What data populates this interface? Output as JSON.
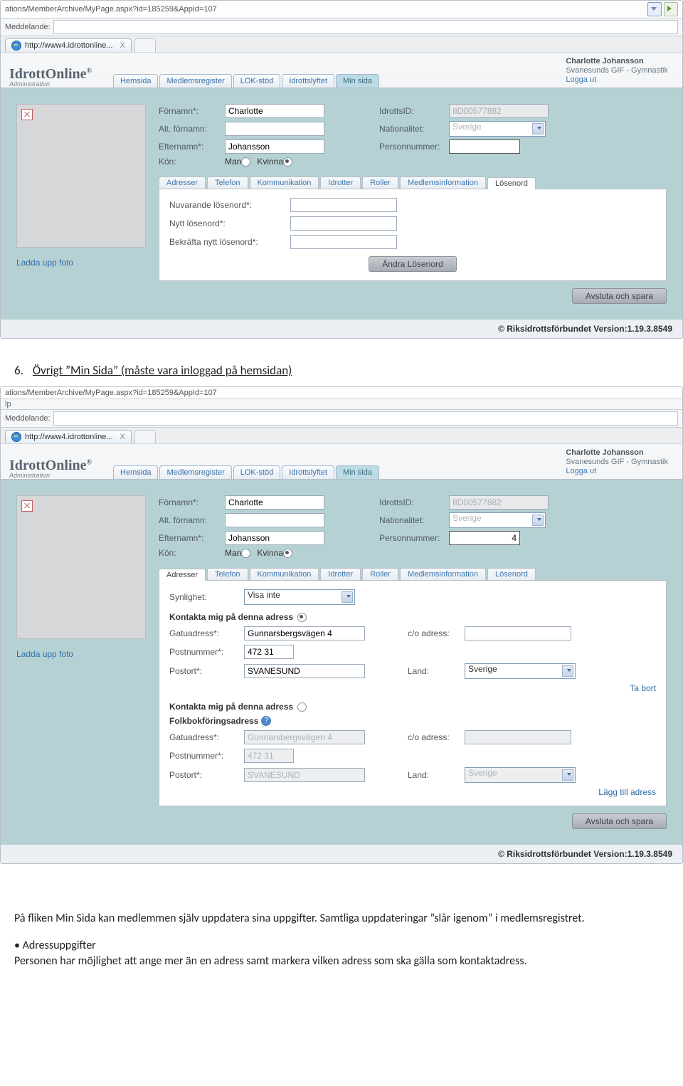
{
  "browser": {
    "url": "ations/MemberArchive/MyPage.aspx?id=185259&AppId=107",
    "help": "lp",
    "meddelande_label": "Meddelande:",
    "tab_title": "http://www4.idrottonline...",
    "tab_close_x": "X"
  },
  "app": {
    "logo": "IdrottOnline",
    "logo_r": "®",
    "logo_sub": "Administration",
    "nav": [
      "Hemsida",
      "Medlemsregister",
      "LOK-stöd",
      "Idrottslyftet",
      "Min sida"
    ],
    "user_name": "Charlotte Johansson",
    "user_org": "Svanesunds GIF - Gymnastik",
    "logout": "Logga ut"
  },
  "person": {
    "labels": {
      "fornamn": "Förnamn*:",
      "alt_fornamn": "Alt. förnamn:",
      "efternamn": "Efternamn*:",
      "kon": "Kön:",
      "man": "Man",
      "kvinna": "Kvinna",
      "idrottsid": "IdrottsID:",
      "nationalitet": "Nationalitet:",
      "personnummer": "Personnummer:"
    },
    "fornamn": "Charlotte",
    "alt_fornamn": "",
    "efternamn": "Johansson",
    "idrottsid": "IID00577882",
    "nationalitet": "Sverige",
    "personnummer": "4"
  },
  "upload_photo": "Ladda upp foto",
  "panel_a": {
    "tabs": [
      "Adresser",
      "Telefon",
      "Kommunikation",
      "Idrotter",
      "Roller",
      "Medlemsinformation",
      "Lösenord"
    ],
    "active_tab": "Lösenord",
    "lbl_current": "Nuvarande lösenord*:",
    "lbl_new": "Nytt lösenord*:",
    "lbl_confirm": "Bekräfta nytt lösenord*:",
    "btn_change": "Ändra Lösenord"
  },
  "save_close": "Avsluta och spara",
  "footer": "© Riksidrottsförbundet Version:1.19.3.8549",
  "heading": {
    "num": "6.",
    "text": "Övrigt ”Min Sida” (måste vara inloggad på hemsidan)"
  },
  "panel_b": {
    "tabs": [
      "Adresser",
      "Telefon",
      "Kommunikation",
      "Idrotter",
      "Roller",
      "Medlemsinformation",
      "Lösenord"
    ],
    "active_tab": "Adresser",
    "synlighet_lbl": "Synlighet:",
    "synlighet_val": "Visa inte",
    "contact_primary": "Kontakta mig på denna adress",
    "gatu_lbl": "Gatuadress*:",
    "postnr_lbl": "Postnummer*:",
    "postort_lbl": "Postort*:",
    "co_lbl": "c/o adress:",
    "land_lbl": "Land:",
    "gatu1": "Gunnarsbergsvägen 4",
    "postnr1": "472 31",
    "postort1": "SVANESUND",
    "land1": "Sverige",
    "remove": "Ta bort",
    "contact_secondary": "Kontakta mig på denna adress",
    "folk": "Folkbokföringsadress",
    "gatu2": "Gunnarsbergsvägen 4",
    "postnr2": "472 31",
    "postort2": "SVANESUND",
    "land2": "Sverige",
    "add": "Lägg till adress"
  },
  "doc": {
    "p1": "På fliken Min Sida kan medlemmen själv uppdatera sina uppgifter. Samtliga uppdateringar ”slår igenom” i medlemsregistret.",
    "bullet": "• Adressuppgifter",
    "p2": "Personen har möjlighet att ange mer än en adress samt markera vilken adress som ska gälla som kontaktadress."
  }
}
